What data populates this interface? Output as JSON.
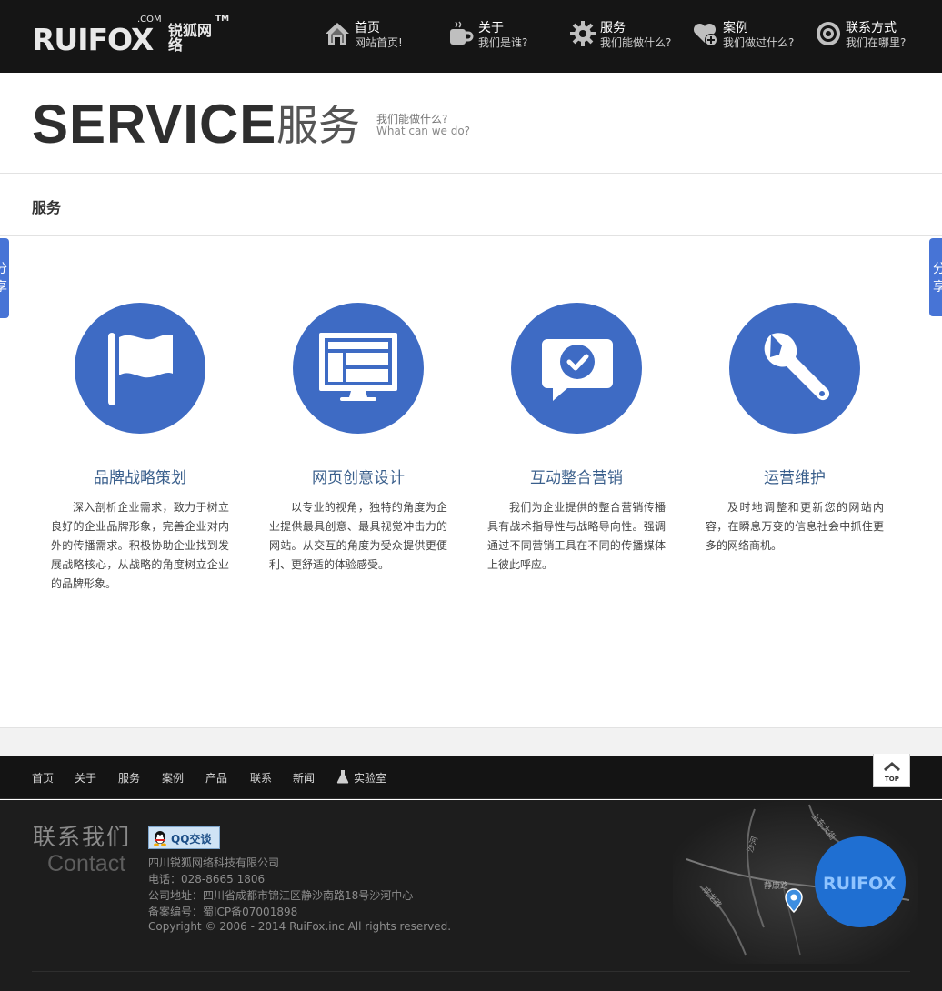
{
  "header": {
    "logo": {
      "text": "RUIFOX",
      "cn": "锐狐网络",
      "dotcom": ".COM",
      "tm": "TM"
    },
    "nav": [
      {
        "title": "首页",
        "subtitle": "网站首页!",
        "icon": "home-icon"
      },
      {
        "title": "关于",
        "subtitle": "我们是谁?",
        "icon": "coffee-cup-icon"
      },
      {
        "title": "服务",
        "subtitle": "我们能做什么?",
        "icon": "gear-icon"
      },
      {
        "title": "案例",
        "subtitle": "我们做过什么?",
        "icon": "heart-plus-icon"
      },
      {
        "title": "联系方式",
        "subtitle": "我们在哪里?",
        "icon": "target-icon"
      }
    ]
  },
  "banner": {
    "title_en": "SERVICE",
    "title_cn": "服务",
    "sub_cn": "我们能做什么?",
    "sub_en": "What can we do?"
  },
  "breadcrumb": {
    "label": "服务"
  },
  "share": {
    "label": "分享"
  },
  "services": [
    {
      "icon": "flag-icon",
      "title": "品牌战略策划",
      "text": "深入剖析企业需求，致力于树立良好的企业品牌形象，完善企业对内外的传播需求。积极协助企业找到发展战略核心，从战略的角度树立企业的品牌形象。"
    },
    {
      "icon": "monitor-icon",
      "title": "网页创意设计",
      "text": "以专业的视角，独特的角度为企业提供最具创意、最具视觉冲击力的网站。从交互的角度为受众提供更便利、更舒适的体验感受。"
    },
    {
      "icon": "chat-check-icon",
      "title": "互动整合营销",
      "text": "我们为企业提供的整合营销传播具有战术指导性与战略导向性。强调通过不同营销工具在不同的传播媒体上彼此呼应。"
    },
    {
      "icon": "wrench-icon",
      "title": "运营维护",
      "text": "及时地调整和更新您的网站内容，在瞬息万变的信息社会中抓住更多的网络商机。"
    }
  ],
  "footer": {
    "nav": [
      "首页",
      "关于",
      "服务",
      "案例",
      "产品",
      "联系",
      "新闻",
      "实验室"
    ],
    "to_top": "TOP",
    "contact_cn": "联系我们",
    "contact_en": "Contact",
    "qq_label": "QQ交谈",
    "company": "四川锐狐网络科技有限公司",
    "phone": "电话：028-8665 1806",
    "address": "公司地址：四川省成都市锦江区静沙南路18号沙河中心",
    "icp": "备案编号：蜀ICP备07001898",
    "copyright": "Copyright © 2006 - 2014 RuiFox.inc All rights reserved.",
    "map": {
      "badge": "RUIFOX",
      "roads": [
        "沙河",
        "上东大街",
        "静康路",
        "成龙路"
      ]
    }
  },
  "colors": {
    "accent": "#3e6bc4",
    "header_bg": "#151515",
    "footer_bg": "#1d1d1d"
  }
}
